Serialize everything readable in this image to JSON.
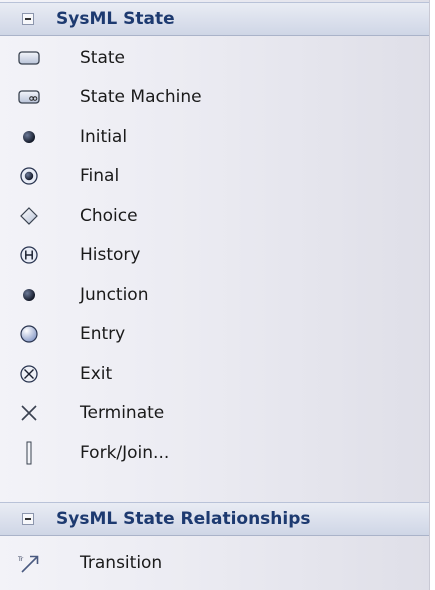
{
  "toolbox": {
    "groups": [
      {
        "title": "SysML State",
        "items": [
          {
            "label": "State",
            "icon": "state-icon"
          },
          {
            "label": "State Machine",
            "icon": "state-machine-icon"
          },
          {
            "label": "Initial",
            "icon": "initial-icon"
          },
          {
            "label": "Final",
            "icon": "final-icon"
          },
          {
            "label": "Choice",
            "icon": "choice-icon"
          },
          {
            "label": "History",
            "icon": "history-icon"
          },
          {
            "label": "Junction",
            "icon": "junction-icon"
          },
          {
            "label": "Entry",
            "icon": "entry-icon"
          },
          {
            "label": "Exit",
            "icon": "exit-icon"
          },
          {
            "label": "Terminate",
            "icon": "terminate-icon"
          },
          {
            "label": "Fork/Join...",
            "icon": "fork-join-icon"
          }
        ]
      },
      {
        "title": "SysML State Relationships",
        "items": [
          {
            "label": "Transition",
            "icon": "transition-icon"
          }
        ]
      }
    ]
  }
}
